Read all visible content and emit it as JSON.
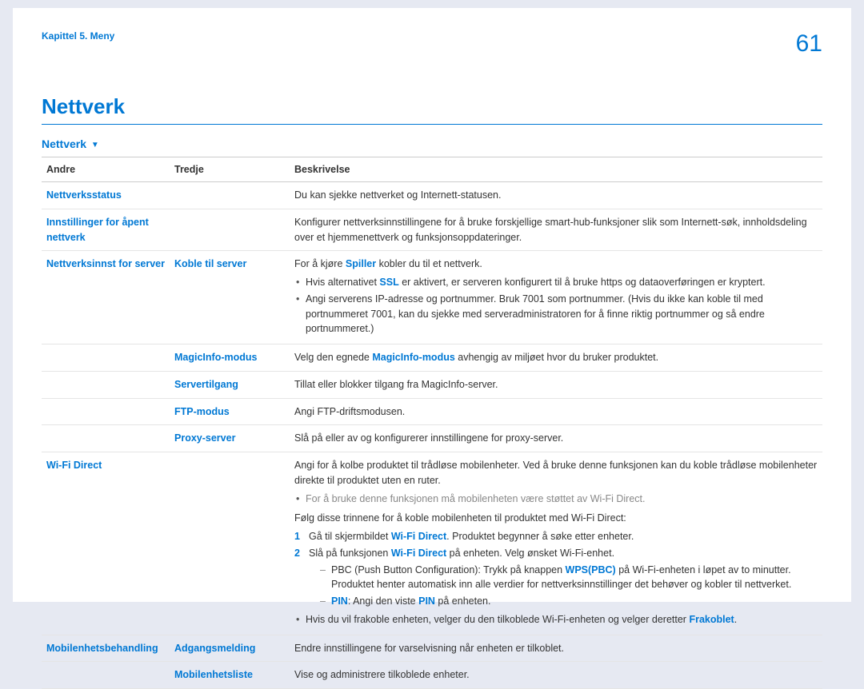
{
  "header": {
    "chapter": "Kapittel 5. Meny",
    "page_number": "61"
  },
  "title": "Nettverk",
  "subtitle": "Nettverk",
  "columns": {
    "c1": "Andre",
    "c2": "Tredje",
    "c3": "Beskrivelse"
  },
  "rows": {
    "r1": {
      "andre": "Nettverksstatus",
      "desc": "Du kan sjekke nettverket og Internett-statusen."
    },
    "r2": {
      "andre": "Innstillinger for åpent nettverk",
      "desc": "Konfigurer nettverksinnstillingene for å bruke forskjellige smart-hub-funksjoner slik som Internett-søk, innholdsdeling over et hjemmenettverk og funksjonsoppdateringer."
    },
    "r3": {
      "andre": "Nettverksinnst for server",
      "tredje": "Koble til server",
      "p1a": "For å kjøre ",
      "spiller": "Spiller",
      "p1b": " kobler du til et nettverk.",
      "b1a": "Hvis alternativet ",
      "ssl": "SSL",
      "b1b": " er aktivert, er serveren konfigurert til å bruke https og dataoverføringen er kryptert.",
      "b2": "Angi serverens IP-adresse og portnummer. Bruk 7001 som portnummer. (Hvis du ikke kan koble til med portnummeret 7001, kan du sjekke med serveradministratoren for å finne riktig portnummer og så endre portnummeret.)"
    },
    "r4": {
      "tredje": "MagicInfo-modus",
      "p1a": "Velg den egnede ",
      "mi": "MagicInfo-modus",
      "p1b": " avhengig av miljøet hvor du bruker produktet."
    },
    "r5": {
      "tredje": "Servertilgang",
      "desc": "Tillat eller blokker tilgang fra MagicInfo-server."
    },
    "r6": {
      "tredje": "FTP-modus",
      "desc": "Angi FTP-driftsmodusen."
    },
    "r7": {
      "tredje": "Proxy-server",
      "desc": "Slå på eller av og konfigurerer innstillingene for proxy-server."
    },
    "r8": {
      "andre": "Wi-Fi Direct",
      "p1": "Angi for å kolbe produktet til trådløse mobilenheter. Ved å bruke denne funksjonen kan du koble trådløse mobilenheter direkte til produktet uten en ruter.",
      "note": "For å bruke denne funksjonen må mobilenheten være støttet av Wi-Fi Direct.",
      "p2": "Følg disse trinnene for å koble mobilenheten til produktet med Wi-Fi Direct:",
      "s1a": "Gå til skjermbildet ",
      "wfd": "Wi-Fi Direct",
      "s1b": ". Produktet begynner å søke etter enheter.",
      "s2a": "Slå på funksjonen ",
      "s2b": " på enheten. Velg ønsket Wi-Fi-enhet.",
      "d1a": "PBC (Push Button Configuration): Trykk på knappen ",
      "wps": "WPS(PBC)",
      "d1b": " på Wi-Fi-enheten i løpet av to minutter. Produktet henter automatisk inn alle verdier for nettverksinnstillinger det behøver og kobler til nettverket.",
      "d2a": "PIN",
      "d2b": ": Angi den viste ",
      "d2c": " på enheten.",
      "b3a": "Hvis du vil frakoble enheten, velger du den tilkoblede Wi-Fi-enheten og velger deretter ",
      "frak": "Frakoblet",
      "b3b": "."
    },
    "r9": {
      "andre": "Mobilenhetsbehandling",
      "tredje": "Adgangsmelding",
      "desc": "Endre innstillingene for varselvisning når enheten er tilkoblet."
    },
    "r10": {
      "tredje": "Mobilenhetsliste",
      "desc": "Vise og administrere tilkoblede enheter."
    }
  }
}
